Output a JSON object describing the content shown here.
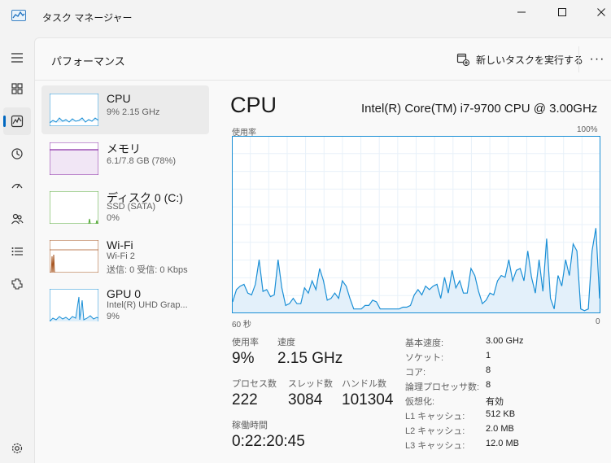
{
  "window": {
    "title": "タスク マネージャー"
  },
  "header": {
    "page_title": "パフォーマンス",
    "run_task_label": "新しいタスクを実行する",
    "more_label": "···"
  },
  "nav": {
    "items": [
      {
        "icon": "hamburger-menu-icon"
      },
      {
        "icon": "processes-icon"
      },
      {
        "icon": "performance-icon",
        "active": true
      },
      {
        "icon": "app-history-icon"
      },
      {
        "icon": "startup-apps-icon"
      },
      {
        "icon": "users-icon"
      },
      {
        "icon": "details-icon"
      },
      {
        "icon": "services-icon"
      },
      {
        "icon": "settings-icon"
      }
    ]
  },
  "perf_list": [
    {
      "name": "CPU",
      "sub1": "9% 2.15 GHz",
      "sub2": "",
      "color": "#1a8fd6"
    },
    {
      "name": "メモリ",
      "sub1": "6.1/7.8 GB (78%)",
      "sub2": "",
      "color": "#8b2fa8"
    },
    {
      "name": "ディスク 0 (C:)",
      "sub1": "SSD (SATA)",
      "sub2": "0%",
      "color": "#4da52f"
    },
    {
      "name": "Wi-Fi",
      "sub1": "Wi-Fi 2",
      "sub2": "送信: 0 受信: 0 Kbps",
      "color": "#a6541f"
    },
    {
      "name": "GPU 0",
      "sub1": "Intel(R) UHD Grap...",
      "sub2": "9%",
      "color": "#1a8fd6"
    }
  ],
  "detail": {
    "title": "CPU",
    "model": "Intel(R) Core(TM) i7-9700 CPU @ 3.00GHz",
    "graph_label": "使用率",
    "graph_max": "100%",
    "x_left": "60 秒",
    "x_right": "0",
    "stats": {
      "usage_label": "使用率",
      "usage_value": "9%",
      "speed_label": "速度",
      "speed_value": "2.15 GHz",
      "processes_label": "プロセス数",
      "processes_value": "222",
      "threads_label": "スレッド数",
      "threads_value": "3084",
      "handles_label": "ハンドル数",
      "handles_value": "101304",
      "uptime_label": "稼働時間",
      "uptime_value": "0:22:20:45"
    },
    "specs": [
      {
        "key": "基本速度:",
        "value": "3.00 GHz"
      },
      {
        "key": "ソケット:",
        "value": "1"
      },
      {
        "key": "コア:",
        "value": "8"
      },
      {
        "key": "論理プロセッサ数:",
        "value": "8"
      },
      {
        "key": "仮想化:",
        "value": "有効"
      },
      {
        "key": "L1 キャッシュ:",
        "value": "512 KB"
      },
      {
        "key": "L2 キャッシュ:",
        "value": "2.0 MB"
      },
      {
        "key": "L3 キャッシュ:",
        "value": "12.0 MB"
      }
    ]
  },
  "chart_data": {
    "type": "area",
    "ylim": [
      0,
      100
    ],
    "series": [
      {
        "values": [
          6,
          13,
          15,
          16,
          11,
          10,
          16,
          30,
          12,
          13,
          9,
          10,
          30,
          14,
          4,
          5,
          8,
          5,
          5,
          14,
          11,
          18,
          13,
          25,
          18,
          7,
          8,
          11,
          8,
          18,
          15,
          8,
          2,
          2,
          2,
          4,
          4,
          7,
          6,
          2,
          2,
          2,
          2,
          2,
          2,
          3,
          3,
          4,
          10,
          13,
          10,
          15,
          13,
          15,
          16,
          8,
          20,
          11,
          24,
          14,
          18,
          11,
          11,
          25,
          21,
          12,
          5,
          7,
          11,
          10,
          18,
          21,
          20,
          30,
          18,
          24,
          25,
          18,
          35,
          20,
          11,
          30,
          12,
          42,
          8,
          2,
          21,
          15,
          30,
          21,
          39,
          35,
          2,
          1,
          2,
          35,
          48,
          8
        ]
      }
    ]
  }
}
